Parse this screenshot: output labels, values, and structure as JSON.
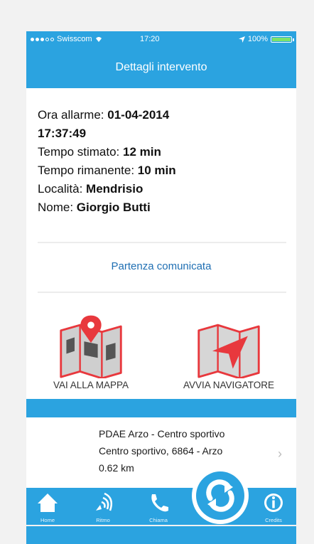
{
  "status": {
    "carrier": "Swisscom",
    "time": "17:20",
    "battery": "100%"
  },
  "nav": {
    "title": "Dettagli intervento"
  },
  "details": {
    "ora_label": "Ora allarme: ",
    "ora_value_date": "01-04-2014",
    "ora_value_time": "17:37:49",
    "tempo_stimato_label": "Tempo stimato: ",
    "tempo_stimato_value": "12 min",
    "tempo_rimanente_label": "Tempo rimanente: ",
    "tempo_rimanente_value": "10 min",
    "localita_label": "Località: ",
    "localita_value": "Mendrisio",
    "nome_label": "Nome: ",
    "nome_value": "Giorgio Butti"
  },
  "partenza": "Partenza comunicata",
  "actions": {
    "map_label": "VAI ALLA MAPPA",
    "nav_label": "AVVIA NAVIGATORE"
  },
  "location": {
    "name": "PDAE Arzo - Centro sportivo",
    "address": "Centro sportivo, 6864 - Arzo",
    "distance": "0.62 km"
  },
  "tabs": {
    "home": "Home",
    "ritmo": "Ritmo",
    "chiama": "Chiama",
    "credits": "Credits"
  },
  "icons": [
    "home-icon",
    "ritmo-icon",
    "phone-icon",
    "sync-icon",
    "info-icon",
    "map-pin-icon",
    "navigation-arrow-icon",
    "chevron-right-icon"
  ],
  "colors": {
    "accent": "#2ba3e0",
    "link": "#1f6fb3",
    "map_red": "#e8383d"
  }
}
